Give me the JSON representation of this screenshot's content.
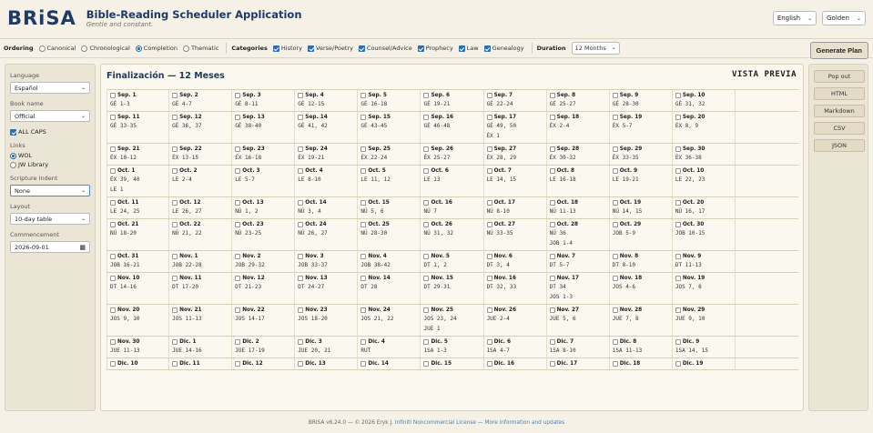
{
  "header": {
    "logo": "BRiSA",
    "title": "Bible-Reading Scheduler Application",
    "tagline": "Gentle and constant.",
    "language_select": "English",
    "theme_select": "Golden"
  },
  "toolbar": {
    "ordering_label": "Ordering",
    "orderings": [
      {
        "label": "Canonical",
        "on": false
      },
      {
        "label": "Chronological",
        "on": false
      },
      {
        "label": "Completion",
        "on": true
      },
      {
        "label": "Thematic",
        "on": false
      }
    ],
    "categories_label": "Categories",
    "categories": [
      {
        "label": "History"
      },
      {
        "label": "Verse/Poetry"
      },
      {
        "label": "Counsel/Advice"
      },
      {
        "label": "Prophecy"
      },
      {
        "label": "Law"
      },
      {
        "label": "Genealogy"
      }
    ],
    "duration_label": "Duration",
    "duration_value": "12 Months",
    "generate_label": "Generate Plan"
  },
  "sidebar": {
    "language_label": "Language",
    "language_value": "Español",
    "book_name_label": "Book name",
    "book_name_value": "Official",
    "all_caps_label": "ALL CAPS",
    "links_label": "Links",
    "links_options": [
      {
        "label": "WOL",
        "on": true
      },
      {
        "label": "JW Library",
        "on": false
      }
    ],
    "indent_label": "Scripture Indent",
    "indent_value": "None",
    "layout_label": "Layout",
    "layout_value": "10-day table",
    "commencement_label": "Commencement",
    "commencement_value": "2026-09-01"
  },
  "main": {
    "title": "Finalización — 12 Meses",
    "preview_label": "VISTA PREVIA",
    "rows": [
      [
        [
          "Sep. 1",
          [
            "GÉ 1-3"
          ]
        ],
        [
          "Sep. 2",
          [
            "GÉ 4-7"
          ]
        ],
        [
          "Sep. 3",
          [
            "GÉ 8-11"
          ]
        ],
        [
          "Sep. 4",
          [
            "GÉ 12-15"
          ]
        ],
        [
          "Sep. 5",
          [
            "GÉ 16-18"
          ]
        ],
        [
          "Sep. 6",
          [
            "GÉ 19-21"
          ]
        ],
        [
          "Sep. 7",
          [
            "GÉ 22-24"
          ]
        ],
        [
          "Sep. 8",
          [
            "GÉ 25-27"
          ]
        ],
        [
          "Sep. 9",
          [
            "GÉ 28-30"
          ]
        ],
        [
          "Sep. 10",
          [
            "GÉ 31, 32"
          ]
        ]
      ],
      [
        [
          "Sep. 11",
          [
            "GÉ 33-35"
          ]
        ],
        [
          "Sep. 12",
          [
            "GÉ 36, 37"
          ]
        ],
        [
          "Sep. 13",
          [
            "GÉ 38-40"
          ]
        ],
        [
          "Sep. 14",
          [
            "GÉ 41, 42"
          ]
        ],
        [
          "Sep. 15",
          [
            "GÉ 43-45"
          ]
        ],
        [
          "Sep. 16",
          [
            "GÉ 46-48"
          ]
        ],
        [
          "Sep. 17",
          [
            "GÉ 49, 50",
            "ÉX 1"
          ]
        ],
        [
          "Sep. 18",
          [
            "ÉX 2-4"
          ]
        ],
        [
          "Sep. 19",
          [
            "ÉX 5-7"
          ]
        ],
        [
          "Sep. 20",
          [
            "ÉX 8, 9"
          ]
        ]
      ],
      [
        [
          "Sep. 21",
          [
            "ÉX 10-12"
          ]
        ],
        [
          "Sep. 22",
          [
            "ÉX 13-15"
          ]
        ],
        [
          "Sep. 23",
          [
            "ÉX 16-18"
          ]
        ],
        [
          "Sep. 24",
          [
            "ÉX 19-21"
          ]
        ],
        [
          "Sep. 25",
          [
            "ÉX 22-24"
          ]
        ],
        [
          "Sep. 26",
          [
            "ÉX 25-27"
          ]
        ],
        [
          "Sep. 27",
          [
            "ÉX 28, 29"
          ]
        ],
        [
          "Sep. 28",
          [
            "ÉX 30-32"
          ]
        ],
        [
          "Sep. 29",
          [
            "ÉX 33-35"
          ]
        ],
        [
          "Sep. 30",
          [
            "ÉX 36-38"
          ]
        ]
      ],
      [
        [
          "Oct. 1",
          [
            "ÉX 39, 40",
            "LE 1"
          ]
        ],
        [
          "Oct. 2",
          [
            "LE 2-4"
          ]
        ],
        [
          "Oct. 3",
          [
            "LE 5-7"
          ]
        ],
        [
          "Oct. 4",
          [
            "LE 8-10"
          ]
        ],
        [
          "Oct. 5",
          [
            "LE 11, 12"
          ]
        ],
        [
          "Oct. 6",
          [
            "LE 13"
          ]
        ],
        [
          "Oct. 7",
          [
            "LE 14, 15"
          ]
        ],
        [
          "Oct. 8",
          [
            "LE 16-18"
          ]
        ],
        [
          "Oct. 9",
          [
            "LE 19-21"
          ]
        ],
        [
          "Oct. 10",
          [
            "LE 22, 23"
          ]
        ]
      ],
      [
        [
          "Oct. 11",
          [
            "LE 24, 25"
          ]
        ],
        [
          "Oct. 12",
          [
            "LE 26, 27"
          ]
        ],
        [
          "Oct. 13",
          [
            "NÚ 1, 2"
          ]
        ],
        [
          "Oct. 14",
          [
            "NÚ 3, 4"
          ]
        ],
        [
          "Oct. 15",
          [
            "NÚ 5, 6"
          ]
        ],
        [
          "Oct. 16",
          [
            "NÚ 7"
          ]
        ],
        [
          "Oct. 17",
          [
            "NÚ 8-10"
          ]
        ],
        [
          "Oct. 18",
          [
            "NÚ 11-13"
          ]
        ],
        [
          "Oct. 19",
          [
            "NÚ 14, 15"
          ]
        ],
        [
          "Oct. 20",
          [
            "NÚ 16, 17"
          ]
        ]
      ],
      [
        [
          "Oct. 21",
          [
            "NÚ 18-20"
          ]
        ],
        [
          "Oct. 22",
          [
            "NÚ 21, 22"
          ]
        ],
        [
          "Oct. 23",
          [
            "NÚ 23-25"
          ]
        ],
        [
          "Oct. 24",
          [
            "NÚ 26, 27"
          ]
        ],
        [
          "Oct. 25",
          [
            "NÚ 28-30"
          ]
        ],
        [
          "Oct. 26",
          [
            "NÚ 31, 32"
          ]
        ],
        [
          "Oct. 27",
          [
            "NÚ 33-35"
          ]
        ],
        [
          "Oct. 28",
          [
            "NÚ 36",
            "JOB 1-4"
          ]
        ],
        [
          "Oct. 29",
          [
            "JOB 5-9"
          ]
        ],
        [
          "Oct. 30",
          [
            "JOB 10-15"
          ]
        ]
      ],
      [
        [
          "Oct. 31",
          [
            "JOB 16-21"
          ]
        ],
        [
          "Nov. 1",
          [
            "JOB 22-28"
          ]
        ],
        [
          "Nov. 2",
          [
            "JOB 29-32"
          ]
        ],
        [
          "Nov. 3",
          [
            "JOB 33-37"
          ]
        ],
        [
          "Nov. 4",
          [
            "JOB 38-42"
          ]
        ],
        [
          "Nov. 5",
          [
            "DT 1, 2"
          ]
        ],
        [
          "Nov. 6",
          [
            "DT 3, 4"
          ]
        ],
        [
          "Nov. 7",
          [
            "DT 5-7"
          ]
        ],
        [
          "Nov. 8",
          [
            "DT 8-10"
          ]
        ],
        [
          "Nov. 9",
          [
            "DT 11-13"
          ]
        ]
      ],
      [
        [
          "Nov. 10",
          [
            "DT 14-16"
          ]
        ],
        [
          "Nov. 11",
          [
            "DT 17-20"
          ]
        ],
        [
          "Nov. 12",
          [
            "DT 21-23"
          ]
        ],
        [
          "Nov. 13",
          [
            "DT 24-27"
          ]
        ],
        [
          "Nov. 14",
          [
            "DT 28"
          ]
        ],
        [
          "Nov. 15",
          [
            "DT 29-31"
          ]
        ],
        [
          "Nov. 16",
          [
            "DT 32, 33"
          ]
        ],
        [
          "Nov. 17",
          [
            "DT 34",
            "JOS 1-3"
          ]
        ],
        [
          "Nov. 18",
          [
            "JOS 4-6"
          ]
        ],
        [
          "Nov. 19",
          [
            "JOS 7, 8"
          ]
        ]
      ],
      [
        [
          "Nov. 20",
          [
            "JOS 9, 10"
          ]
        ],
        [
          "Nov. 21",
          [
            "JOS 11-13"
          ]
        ],
        [
          "Nov. 22",
          [
            "JOS 14-17"
          ]
        ],
        [
          "Nov. 23",
          [
            "JOS 18-20"
          ]
        ],
        [
          "Nov. 24",
          [
            "JOS 21, 22"
          ]
        ],
        [
          "Nov. 25",
          [
            "JOS 23, 24",
            "JUE 1"
          ]
        ],
        [
          "Nov. 26",
          [
            "JUE 2-4"
          ]
        ],
        [
          "Nov. 27",
          [
            "JUE 5, 6"
          ]
        ],
        [
          "Nov. 28",
          [
            "JUE 7, 8"
          ]
        ],
        [
          "Nov. 29",
          [
            "JUE 9, 10"
          ]
        ]
      ],
      [
        [
          "Nov. 30",
          [
            "JUE 11-13"
          ]
        ],
        [
          "Dic. 1",
          [
            "JUE 14-16"
          ]
        ],
        [
          "Dic. 2",
          [
            "JUE 17-19"
          ]
        ],
        [
          "Dic. 3",
          [
            "JUE 20, 21"
          ]
        ],
        [
          "Dic. 4",
          [
            "RUT"
          ]
        ],
        [
          "Dic. 5",
          [
            "1SA 1-3"
          ]
        ],
        [
          "Dic. 6",
          [
            "1SA 4-7"
          ]
        ],
        [
          "Dic. 7",
          [
            "1SA 8-10"
          ]
        ],
        [
          "Dic. 8",
          [
            "1SA 11-13"
          ]
        ],
        [
          "Dic. 9",
          [
            "1SA 14, 15"
          ]
        ]
      ],
      [
        [
          "Dic. 10",
          []
        ],
        [
          "Dic. 11",
          []
        ],
        [
          "Dic. 12",
          []
        ],
        [
          "Dic. 13",
          []
        ],
        [
          "Dic. 14",
          []
        ],
        [
          "Dic. 15",
          []
        ],
        [
          "Dic. 16",
          []
        ],
        [
          "Dic. 17",
          []
        ],
        [
          "Dic. 18",
          []
        ],
        [
          "Dic. 19",
          []
        ]
      ]
    ]
  },
  "rightbar": {
    "buttons": [
      "Pop out",
      "HTML",
      "Markdown",
      "CSV",
      "JSON"
    ]
  },
  "footer": {
    "text": "BRISA v6.24.0 — © 2026 Eryk J.",
    "license_link": "Infiniti Noncommercial License",
    "sep": "—",
    "more_link": "More information and updates"
  },
  "colors": {
    "accent": "#2c6fb0",
    "title": "#1e3a66",
    "background": "#f5f1e6"
  }
}
